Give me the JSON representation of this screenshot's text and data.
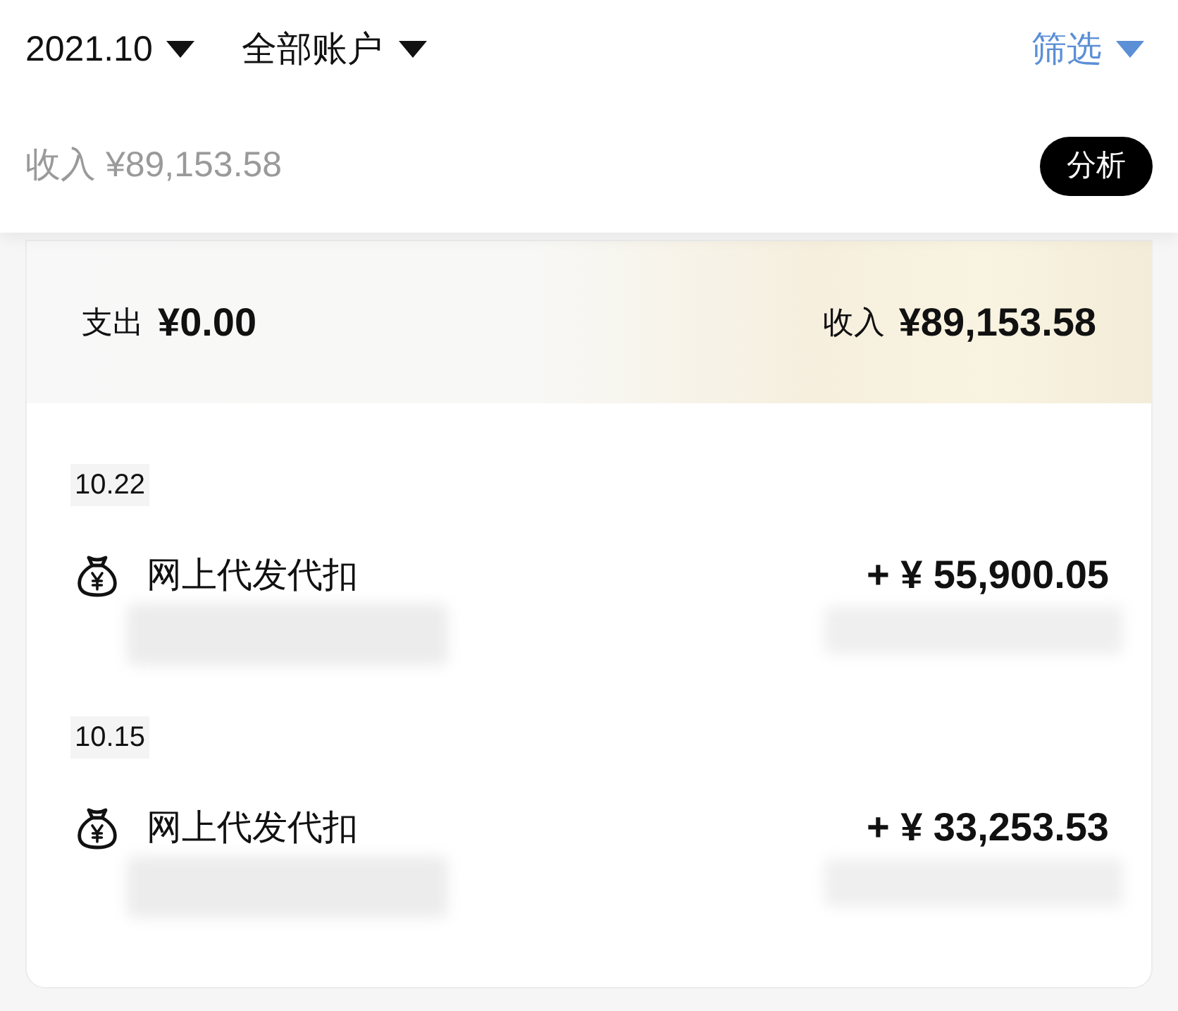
{
  "header": {
    "month": "2021.10",
    "account": "全部账户",
    "filter": "筛选",
    "income_summary": "收入 ¥89,153.58",
    "analysis_button": "分析"
  },
  "summary": {
    "expense_label": "支出",
    "expense_amount": "¥0.00",
    "income_label": "收入",
    "income_amount": "¥89,153.58"
  },
  "groups": [
    {
      "date": "10.22",
      "transactions": [
        {
          "title": "网上代发代扣",
          "amount": "+ ¥ 55,900.05"
        }
      ]
    },
    {
      "date": "10.15",
      "transactions": [
        {
          "title": "网上代发代扣",
          "amount": "+ ¥ 33,253.53"
        }
      ]
    }
  ]
}
